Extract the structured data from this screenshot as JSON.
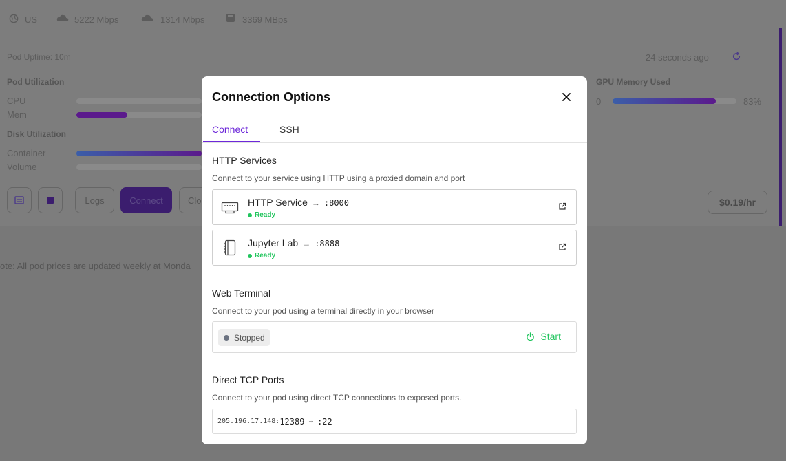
{
  "background": {
    "top_row": {
      "region": "US",
      "download": "5222 Mbps",
      "upload": "1314 Mbps",
      "disk": "3369 MBps"
    },
    "uptime": "Pod Uptime: 10m",
    "last_updated": "24 seconds ago",
    "pod_utilization_label": "Pod Utilization",
    "cpu_label": "CPU",
    "mem_label": "Mem",
    "disk_utilization_label": "Disk Utilization",
    "container_label": "Container",
    "volume_label": "Volume",
    "gpu_memory_label": "GPU Memory Used",
    "gpu_index": "0",
    "gpu_memory_percent": "83%",
    "gpu_memory_fraction": 0.83,
    "mem_fraction": 0.4,
    "buttons": {
      "logs": "Logs",
      "connect": "Connect",
      "cloud": "Clo"
    },
    "price": "$0.19/hr",
    "note": "ote: All pod prices are updated weekly at Monda",
    "colors": {
      "accent": "#3b1d6e",
      "bar_gradient_start": "#3b82f6",
      "bar_gradient_end": "#7e22ce"
    }
  },
  "modal": {
    "title": "Connection Options",
    "tabs": [
      {
        "label": "Connect",
        "active": true
      },
      {
        "label": "SSH",
        "active": false
      }
    ],
    "http": {
      "title": "HTTP Services",
      "description": "Connect to your service using HTTP using a proxied domain and port",
      "services": [
        {
          "name": "HTTP Service",
          "port": ":8000",
          "status": "Ready",
          "icon": "ethernet-port-icon"
        },
        {
          "name": "Jupyter Lab",
          "port": ":8888",
          "status": "Ready",
          "icon": "notebook-icon"
        }
      ]
    },
    "terminal": {
      "title": "Web Terminal",
      "description": "Connect to your pod using a terminal directly in your browser",
      "status": "Stopped",
      "start_label": "Start"
    },
    "tcp": {
      "title": "Direct TCP Ports",
      "description": "Connect to your pod using direct TCP connections to exposed ports.",
      "ip": "205.196.17.148:",
      "external_port": "12389",
      "internal_port": ":22"
    },
    "colors": {
      "accent": "#6d28d9",
      "success": "#22c55e",
      "muted": "#6b7280"
    }
  }
}
